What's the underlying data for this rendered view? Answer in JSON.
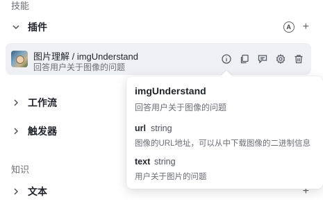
{
  "sections": {
    "skills_label": "技能",
    "knowledge_label": "知识"
  },
  "plugins_row": {
    "title": "插件",
    "auto_badge": "A",
    "add": "+"
  },
  "plugin": {
    "name": "图片理解 / imgUnderstand",
    "description": "回答用户关于图像的问题",
    "actions": [
      "info-icon",
      "copy-icon",
      "edit-note-icon",
      "settings-icon",
      "delete-icon"
    ]
  },
  "workflow_row": {
    "title": "工作流"
  },
  "trigger_row": {
    "title": "触发器"
  },
  "text_row": {
    "title": "文本",
    "add": "+"
  },
  "popover": {
    "title": "imgUnderstand",
    "subtitle": "回答用户关于图像的问题",
    "params": [
      {
        "name": "url",
        "type": "string",
        "description": "图像的URL地址，可以从中下载图像的二进制信息"
      },
      {
        "name": "text",
        "type": "string",
        "description": "用户关于图片的问题"
      }
    ]
  }
}
